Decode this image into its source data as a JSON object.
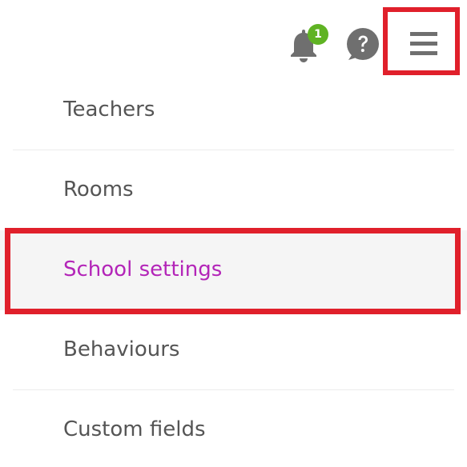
{
  "toolbar": {
    "notifications": {
      "icon": "bell-icon",
      "count": "1",
      "badge_color": "#5fb323"
    },
    "help": {
      "icon": "help-icon",
      "glyph": "?"
    },
    "menu_toggle": {
      "icon": "hamburger-icon"
    }
  },
  "menu": {
    "items": [
      {
        "label": "Teachers"
      },
      {
        "label": "Rooms"
      },
      {
        "label": "School settings",
        "active": true
      },
      {
        "label": "Behaviours"
      },
      {
        "label": "Custom fields"
      }
    ],
    "active_color": "#b325b8",
    "text_color": "#555555"
  },
  "highlight_color": "#e0202b"
}
